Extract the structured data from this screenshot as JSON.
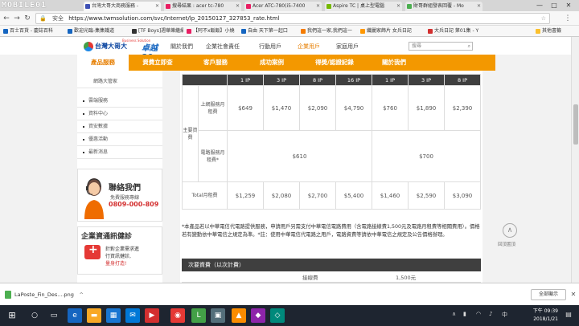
{
  "watermark": "MOBILE01",
  "tabs": [
    {
      "label": "台灣大哥大商務服務 -",
      "color": "#3f51b5"
    },
    {
      "label": "搜尋結果 : acer tc-780",
      "color": "#e91e63"
    },
    {
      "label": "Acer ATC-780(i5-7400",
      "color": "#e91e63"
    },
    {
      "label": "Aspire TC | 桌上型電腦",
      "color": "#76b900"
    },
    {
      "label": "財哥群組發表回覆 - Mo",
      "color": "#4caf50"
    }
  ],
  "address": {
    "secure_label": "安全",
    "url": "https://www.twmsolution.com/svc/Internet/lp_20150127_327853_rate.html"
  },
  "bookmarks": [
    {
      "label": "百士百貨 - 慶誌百科",
      "color": "#1565c0"
    },
    {
      "label": "歡迎光臨-集集鐵道",
      "color": "#1565c0"
    },
    {
      "label": "[TF Boys]週華樂繼續",
      "color": "#333333"
    },
    {
      "label": "【阿不x飯飯】小燒",
      "color": "#e91e63"
    },
    {
      "label": "自由 天下第一起口",
      "color": "#1565c0"
    },
    {
      "label": "我們這一家,我們這一",
      "color": "#f57c00"
    },
    {
      "label": "纖麗家飾片 女兵日記",
      "color": "#ff9800"
    },
    {
      "label": "大兵日記 第01集 - Y",
      "color": "#d32f2f"
    },
    {
      "label": "其他書籤",
      "color": "#fbc02d"
    }
  ],
  "site": {
    "logo_name": "台灣大哥大",
    "logo_sub": "Business Solution",
    "logo_mark": "卓越20",
    "topnav": [
      "關於我們",
      "企業社會責任",
      "行動用戶",
      "企業用戶",
      "家庭用戶"
    ],
    "topnav_active": 3,
    "search_placeholder": "搜尋",
    "mainnav": [
      "產品服務",
      "資費立即查",
      "客戶服務",
      "成功案例",
      "得獎/認證記錄",
      "關於我們"
    ],
    "mainnav_active": 0
  },
  "sidebar": {
    "top_sub": "網路大管家",
    "items": [
      "雲端服務",
      "資料中心",
      "資安數據",
      "優惠活動",
      "最新消息"
    ],
    "promo1": {
      "title": "聯絡我們",
      "sub": "免費服務專線",
      "phone": "0809-000-809"
    },
    "promo2": {
      "title": "企業資通訊健診",
      "lines": [
        "針對企業需求進",
        "行資訊健診,",
        "量身打造!"
      ]
    }
  },
  "table": {
    "headers": [
      "",
      "",
      "1 IP",
      "3 IP",
      "8 IP",
      "16 IP",
      "1 IP",
      "3 IP",
      "8 IP"
    ],
    "group_label": "主要資費",
    "rows": [
      {
        "label": "上網服務月租費",
        "values": [
          "$649",
          "$1,470",
          "$2,090",
          "$4,790",
          "$760",
          "$1,890",
          "$2,390"
        ]
      },
      {
        "label": "電路服務月租費*",
        "merged": [
          "$610",
          "$700"
        ]
      },
      {
        "label": "Total月租費",
        "values": [
          "$1,259",
          "$2,080",
          "$2,700",
          "$5,400",
          "$1,460",
          "$2,590",
          "$3,090"
        ]
      }
    ]
  },
  "note": "*本產品若以中華電信代電路提供服務，申請用戶另需支付中華電信電路費用（含電路接線費1,500元及電路月租費等相關費用）。價格若有變動依中華電信之規定為準。*註：使用中華電信代電路之用戶，電路資費等請依中華電信之規定及公告價格辦理。",
  "secondary": {
    "title": "次要資費（以次計費）",
    "row_label": "接線費",
    "row_value": "1,500元"
  },
  "totop_label": "回頂置頂",
  "download": {
    "filename": "LaPoste_Fin_Des....png",
    "show_all": "全部顯示"
  },
  "clock": {
    "time": "下午 09:39",
    "date": "2018/1/21"
  }
}
